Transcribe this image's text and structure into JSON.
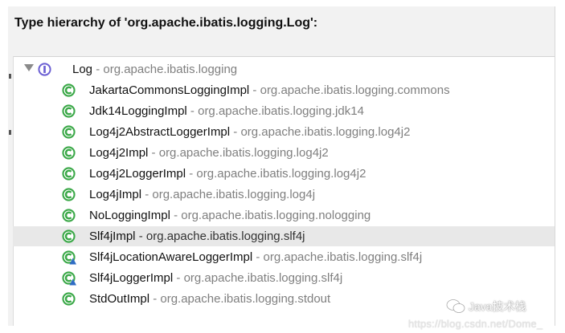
{
  "title": "Type hierarchy of 'org.apache.ibatis.logging.Log':",
  "root": {
    "name": "Log",
    "pkg": " - org.apache.ibatis.logging",
    "icon": "interface-icon"
  },
  "items": [
    {
      "name": "JakartaCommonsLoggingImpl",
      "pkg": " - org.apache.ibatis.logging.commons",
      "icon": "class-icon",
      "selected": false
    },
    {
      "name": "Jdk14LoggingImpl",
      "pkg": " - org.apache.ibatis.logging.jdk14",
      "icon": "class-icon",
      "selected": false
    },
    {
      "name": "Log4j2AbstractLoggerImpl",
      "pkg": " - org.apache.ibatis.logging.log4j2",
      "icon": "class-icon",
      "selected": false
    },
    {
      "name": "Log4j2Impl",
      "pkg": " - org.apache.ibatis.logging.log4j2",
      "icon": "class-icon",
      "selected": false
    },
    {
      "name": "Log4j2LoggerImpl",
      "pkg": " - org.apache.ibatis.logging.log4j2",
      "icon": "class-icon",
      "selected": false
    },
    {
      "name": "Log4jImpl",
      "pkg": " - org.apache.ibatis.logging.log4j",
      "icon": "class-icon",
      "selected": false
    },
    {
      "name": "NoLoggingImpl",
      "pkg": " - org.apache.ibatis.logging.nologging",
      "icon": "class-icon",
      "selected": false
    },
    {
      "name": "Slf4jImpl",
      "pkg": " - org.apache.ibatis.logging.slf4j",
      "icon": "class-icon",
      "selected": true
    },
    {
      "name": "Slf4jLocationAwareLoggerImpl",
      "pkg": " - org.apache.ibatis.logging.slf4j",
      "icon": "class-with-marker-icon",
      "selected": false
    },
    {
      "name": "Slf4jLoggerImpl",
      "pkg": " - org.apache.ibatis.logging.slf4j",
      "icon": "class-with-marker-icon",
      "selected": false
    },
    {
      "name": "StdOutImpl",
      "pkg": " - org.apache.ibatis.logging.stdout",
      "icon": "class-icon",
      "selected": false
    }
  ],
  "watermark": {
    "text": "Java技术栈",
    "url": "https://blog.csdn.net/Dome_"
  },
  "colors": {
    "class_icon": "#3aa847",
    "interface_icon": "#6b5fd3",
    "marker": "#2f6cc4",
    "selected_row": "#e8e8e8"
  }
}
